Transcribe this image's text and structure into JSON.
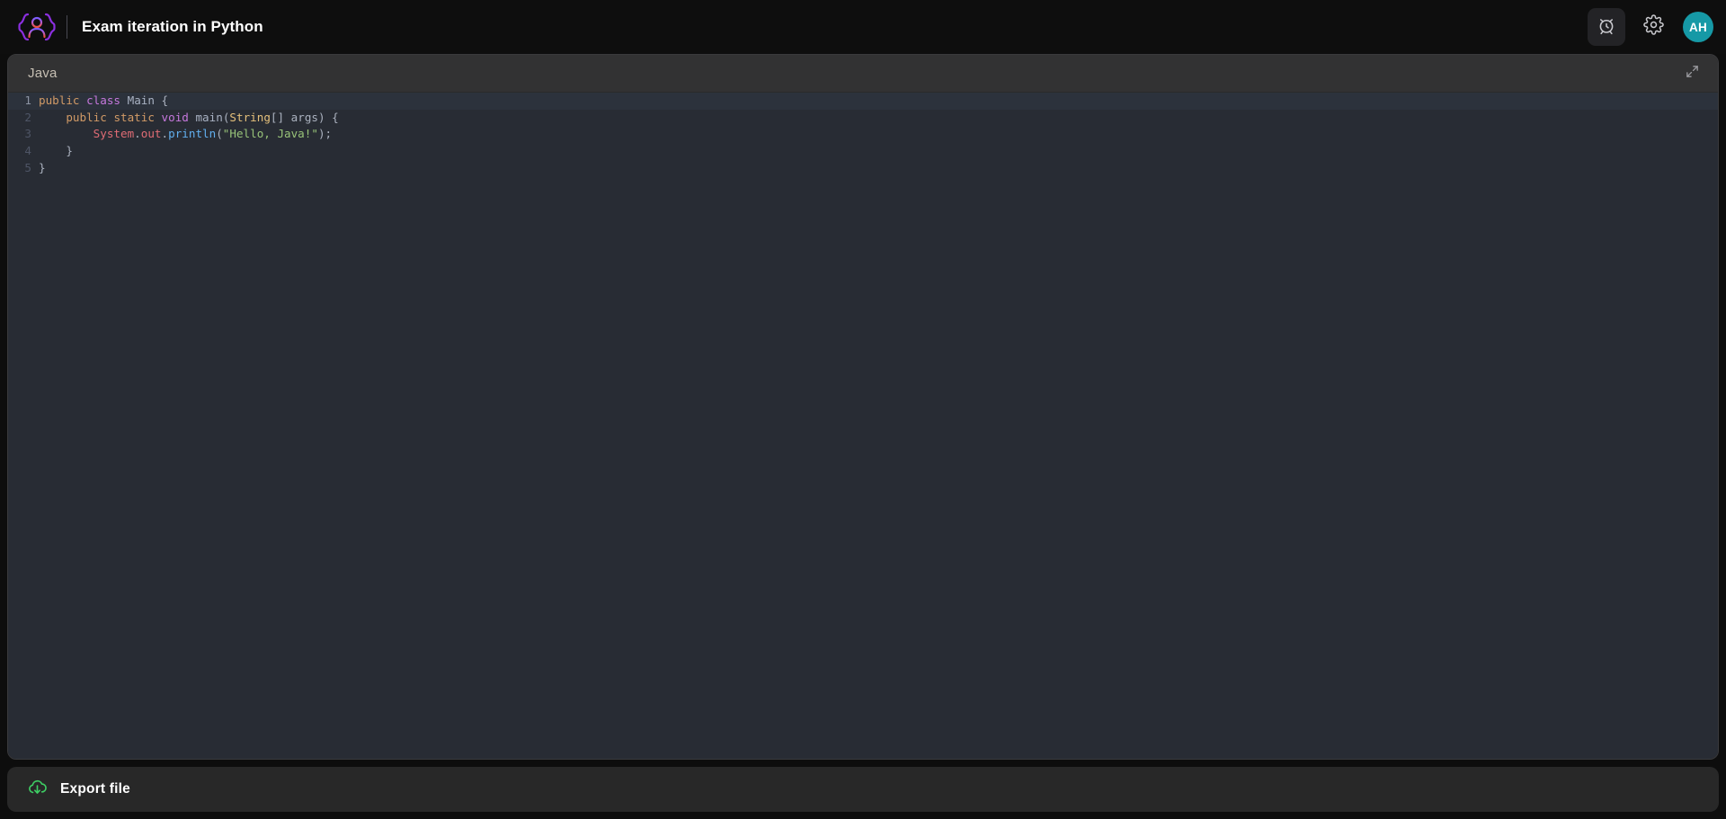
{
  "topbar": {
    "logo_icon": "braces-person-logo-icon",
    "title": "Exam iteration in Python",
    "actions": [
      {
        "icon": "alarm-clock-icon",
        "name": "timer-button"
      },
      {
        "icon": "gear-icon",
        "name": "settings-button"
      }
    ],
    "avatar_initials": "AH",
    "avatar_color": "#1699a6"
  },
  "editor": {
    "language": "Java",
    "expand_icon": "expand-diagonal-icon",
    "active_line": 1,
    "lines": [
      {
        "number": "1",
        "tokens": [
          {
            "text": "public",
            "type": "mod"
          },
          {
            "text": " ",
            "type": "pun"
          },
          {
            "text": "class",
            "type": "kw"
          },
          {
            "text": " ",
            "type": "pun"
          },
          {
            "text": "Main",
            "type": "cls"
          },
          {
            "text": " {",
            "type": "pun"
          }
        ]
      },
      {
        "number": "2",
        "tokens": [
          {
            "text": "    ",
            "type": "pun"
          },
          {
            "text": "public",
            "type": "mod"
          },
          {
            "text": " ",
            "type": "pun"
          },
          {
            "text": "static",
            "type": "mod"
          },
          {
            "text": " ",
            "type": "pun"
          },
          {
            "text": "void",
            "type": "kw"
          },
          {
            "text": " ",
            "type": "pun"
          },
          {
            "text": "main",
            "type": "cls"
          },
          {
            "text": "(",
            "type": "pun"
          },
          {
            "text": "String",
            "type": "type"
          },
          {
            "text": "[] args) {",
            "type": "pun"
          }
        ]
      },
      {
        "number": "3",
        "tokens": [
          {
            "text": "        ",
            "type": "pun"
          },
          {
            "text": "System",
            "type": "obj"
          },
          {
            "text": ".",
            "type": "pun"
          },
          {
            "text": "out",
            "type": "obj"
          },
          {
            "text": ".",
            "type": "pun"
          },
          {
            "text": "println",
            "type": "fn"
          },
          {
            "text": "(",
            "type": "pun"
          },
          {
            "text": "\"Hello, Java!\"",
            "type": "str"
          },
          {
            "text": ");",
            "type": "pun"
          }
        ]
      },
      {
        "number": "4",
        "tokens": [
          {
            "text": "    }",
            "type": "pun"
          }
        ]
      },
      {
        "number": "5",
        "tokens": [
          {
            "text": "}",
            "type": "pun"
          }
        ]
      }
    ],
    "raw_code": "public class Main {\n    public static void main(String[] args) {\n        System.out.println(\"Hello, Java!\");\n    }\n}"
  },
  "footer": {
    "export_icon": "cloud-download-icon",
    "export_label": "Export file",
    "export_icon_color": "#3ecf64"
  }
}
